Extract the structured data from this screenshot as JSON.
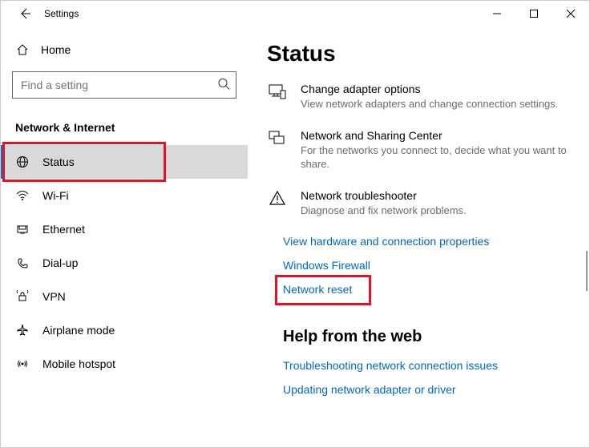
{
  "window": {
    "title": "Settings"
  },
  "sidebar": {
    "home_label": "Home",
    "search_placeholder": "Find a setting",
    "category": "Network & Internet",
    "items": [
      {
        "label": "Status"
      },
      {
        "label": "Wi-Fi"
      },
      {
        "label": "Ethernet"
      },
      {
        "label": "Dial-up"
      },
      {
        "label": "VPN"
      },
      {
        "label": "Airplane mode"
      },
      {
        "label": "Mobile hotspot"
      }
    ]
  },
  "main": {
    "title": "Status",
    "options": [
      {
        "title": "Change adapter options",
        "desc": "View network adapters and change connection settings."
      },
      {
        "title": "Network and Sharing Center",
        "desc": "For the networks you connect to, decide what you want to share."
      },
      {
        "title": "Network troubleshooter",
        "desc": "Diagnose and fix network problems."
      }
    ],
    "links": [
      "View hardware and connection properties",
      "Windows Firewall",
      "Network reset"
    ],
    "help_heading": "Help from the web",
    "help_links": [
      "Troubleshooting network connection issues",
      "Updating network adapter or driver"
    ]
  }
}
